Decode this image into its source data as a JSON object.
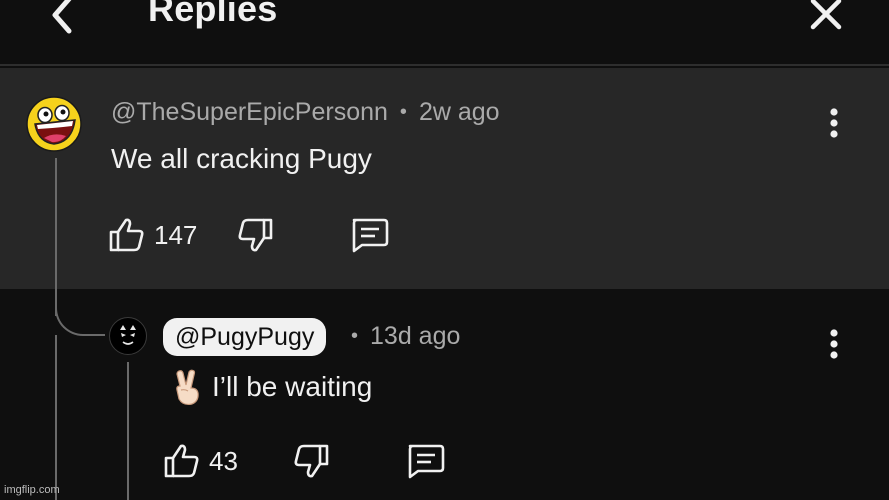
{
  "header": {
    "title": "Replies",
    "back_icon": "chevron-left-icon",
    "close_icon": "close-icon"
  },
  "comment": {
    "author": "@TheSuperEpicPersonn",
    "separator": "•",
    "time": "2w ago",
    "text": "We all cracking Pugy",
    "likes": "147",
    "avatar_icon": "awesome-face-icon"
  },
  "reply": {
    "author": "@PugyPugy",
    "separator": "•",
    "time": "13d ago",
    "text": "I’ll be waiting",
    "emoji_icon": "victory-hand-icon",
    "likes": "43",
    "avatar_icon": "dark-cat-avatar-icon"
  },
  "watermark": "imgflip.com",
  "colors": {
    "background": "#0f0f0f",
    "highlight": "#272727",
    "text": "#f1f1f1",
    "meta": "#aaaaaa"
  }
}
